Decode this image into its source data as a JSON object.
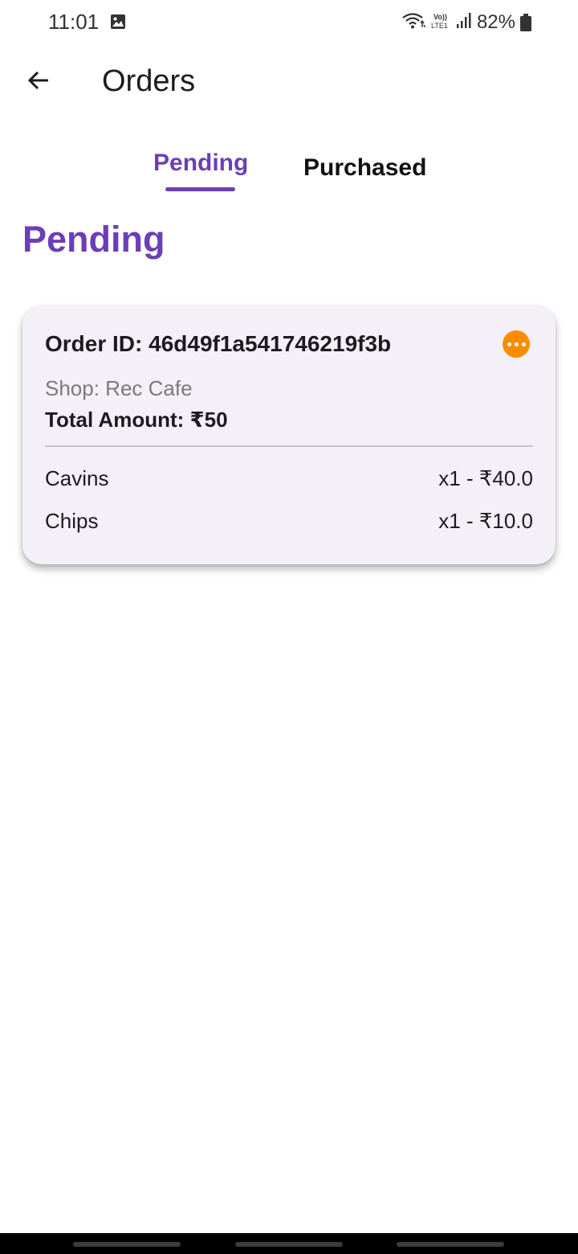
{
  "status_bar": {
    "time": "11:01",
    "battery": "82%",
    "icons": [
      "gallery-icon",
      "wifi-icon",
      "volte-icon",
      "signal-icon",
      "battery-icon"
    ]
  },
  "app_bar": {
    "title": "Orders",
    "back_icon": "arrow-left-icon"
  },
  "tabs": [
    {
      "label": "Pending",
      "selected": true
    },
    {
      "label": "Purchased",
      "selected": false
    }
  ],
  "section_heading": "Pending",
  "colors": {
    "accent": "#6b3fb6",
    "status_pending": "#fb8c00",
    "card_bg": "#f4f0f7"
  },
  "orders": [
    {
      "order_id": "Order ID: 46d49f1a541746219f3b",
      "shop": "Shop: Rec Cafe",
      "total": "Total Amount: ₹50",
      "status_icon": "more-horizontal-icon",
      "items": [
        {
          "name": "Cavins",
          "price": "x1 - ₹40.0"
        },
        {
          "name": "Chips",
          "price": "x1 - ₹10.0"
        }
      ]
    }
  ]
}
